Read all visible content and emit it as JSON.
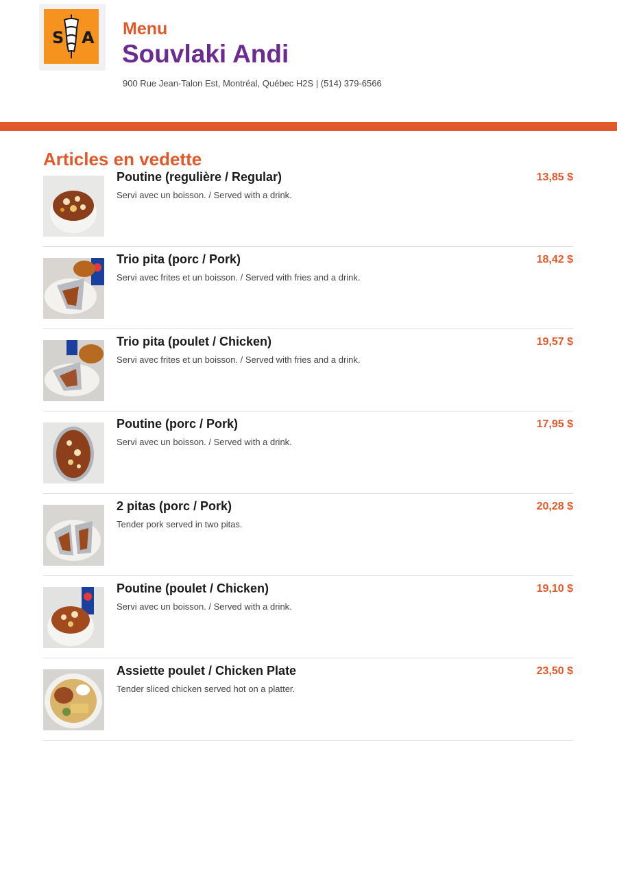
{
  "header": {
    "menu_label": "Menu",
    "restaurant_name": "Souvlaki Andi",
    "address": "900 Rue Jean-Talon Est, Montréal, Québec H2S | (514) 379-6566",
    "logo_icon": "souvlaki-andi-logo-icon"
  },
  "colors": {
    "accent": "#e1592a",
    "brand_purple": "#6a2c91",
    "logo_orange": "#f6931f"
  },
  "section": {
    "title": "Articles en vedette",
    "items": [
      {
        "name": "Poutine (regulière / Regular)",
        "description": "Servi avec un boisson. / Served with a drink.",
        "price": "13,85 $",
        "image": "poutine-regular-photo"
      },
      {
        "name": "Trio pita (porc / Pork)",
        "description": "Servi avec frites et un boisson. / Served with fries and a drink.",
        "price": "18,42 $",
        "image": "trio-pita-pork-photo"
      },
      {
        "name": "Trio pita (poulet / Chicken)",
        "description": "Servi avec frites et un boisson. / Served with fries and a drink.",
        "price": "19,57 $",
        "image": "trio-pita-chicken-photo"
      },
      {
        "name": "Poutine (porc / Pork)",
        "description": "Servi avec un boisson. / Served with a drink.",
        "price": "17,95 $",
        "image": "poutine-pork-photo"
      },
      {
        "name": "2 pitas (porc / Pork)",
        "description": "Tender pork served in two pitas.",
        "price": "20,28 $",
        "image": "two-pitas-pork-photo"
      },
      {
        "name": "Poutine (poulet / Chicken)",
        "description": "Servi avec un boisson. / Served with a drink.",
        "price": "19,10 $",
        "image": "poutine-chicken-photo"
      },
      {
        "name": "Assiette poulet / Chicken Plate",
        "description": "Tender sliced chicken served hot on a platter.",
        "price": "23,50 $",
        "image": "chicken-plate-photo"
      }
    ]
  }
}
